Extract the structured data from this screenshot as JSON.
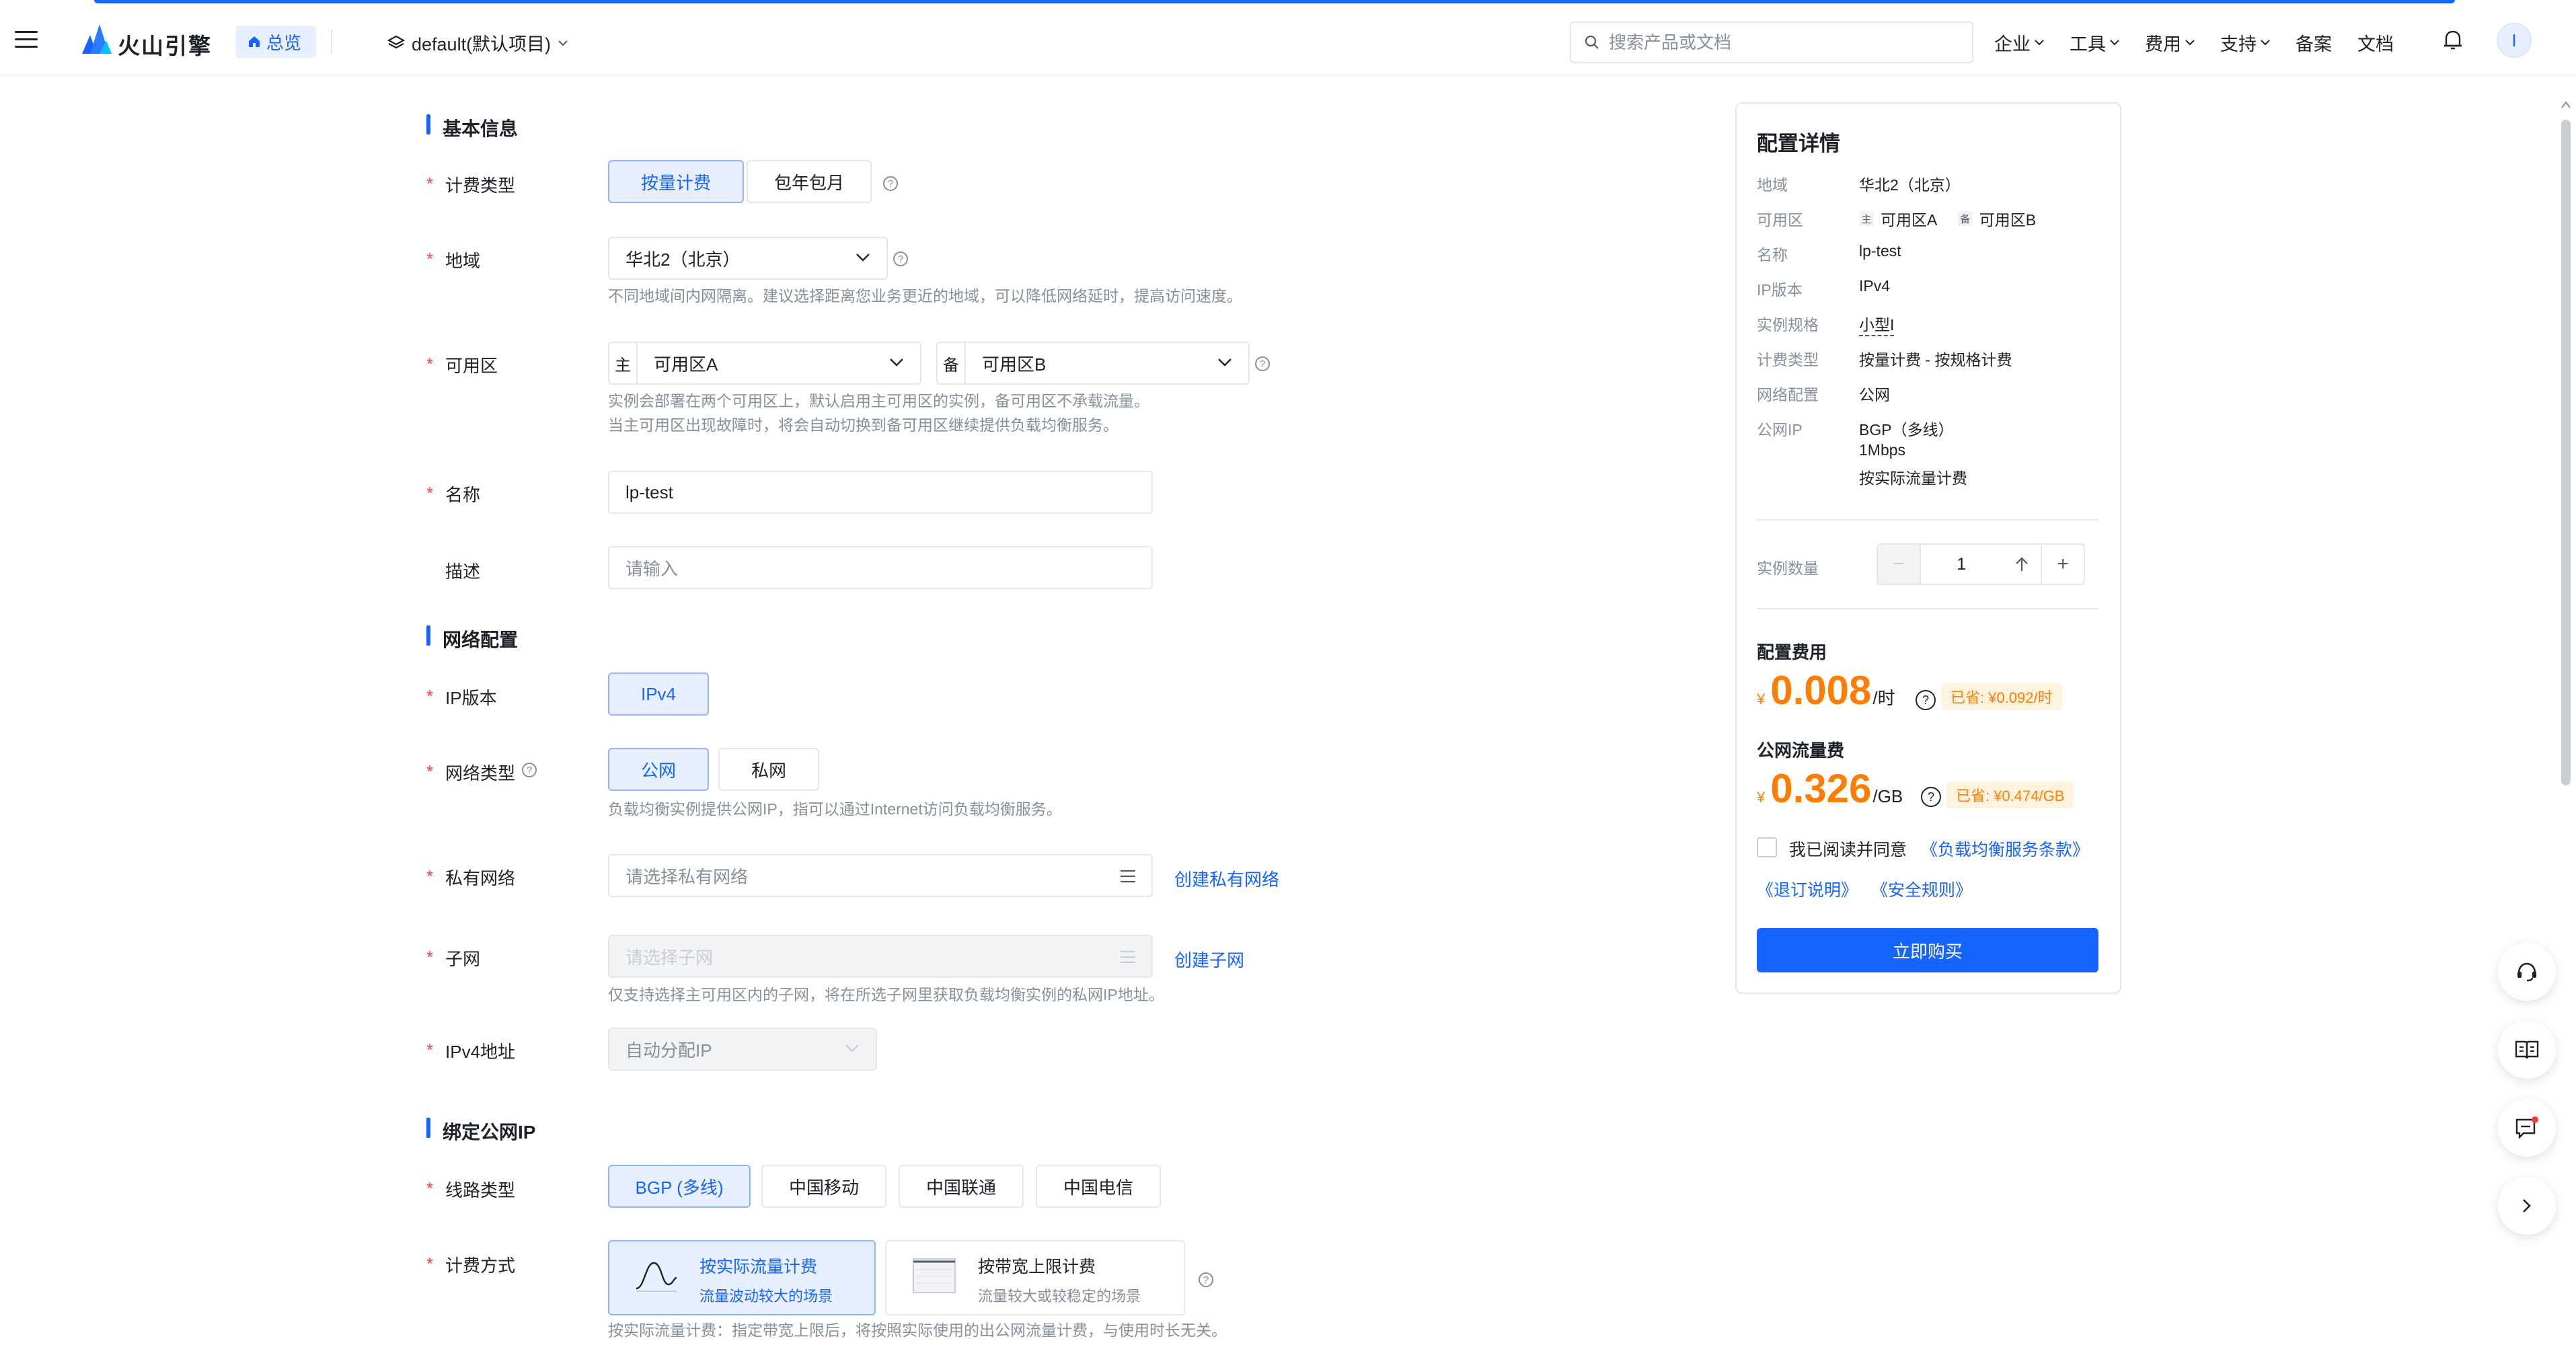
{
  "header": {
    "brand": "火山引擎",
    "home_tag": "总览",
    "project": "default(默认项目)",
    "search_placeholder": "搜索产品或文档",
    "nav": [
      "企业",
      "工具",
      "费用",
      "支持",
      "备案",
      "文档"
    ],
    "avatar_initial": "I"
  },
  "form": {
    "basic": {
      "title": "基本信息",
      "billing_label": "计费类型",
      "billing_options": [
        "按量计费",
        "包年包月"
      ],
      "region_label": "地域",
      "region_value": "华北2（北京）",
      "region_hint": "不同地域间内网隔离。建议选择距离您业务更近的地域，可以降低网络延时，提高访问速度。",
      "zone_label": "可用区",
      "zone_primary_prefix": "主",
      "zone_primary": "可用区A",
      "zone_backup_prefix": "备",
      "zone_backup": "可用区B",
      "zone_hint_1": "实例会部署在两个可用区上，默认启用主可用区的实例，备可用区不承载流量。",
      "zone_hint_2": "当主可用区出现故障时，将会自动切换到备可用区继续提供负载均衡服务。",
      "name_label": "名称",
      "name_value": "lp-test",
      "desc_label": "描述",
      "desc_placeholder": "请输入"
    },
    "network": {
      "title": "网络配置",
      "ip_label": "IP版本",
      "ip_value": "IPv4",
      "type_label": "网络类型",
      "type_options": [
        "公网",
        "私网"
      ],
      "type_hint": "负载均衡实例提供公网IP，指可以通过Internet访问负载均衡服务。",
      "vpc_label": "私有网络",
      "vpc_placeholder": "请选择私有网络",
      "vpc_link": "创建私有网络",
      "subnet_label": "子网",
      "subnet_placeholder": "请选择子网",
      "subnet_link": "创建子网",
      "subnet_hint": "仅支持选择主可用区内的子网，将在所选子网里获取负载均衡实例的私网IP地址。",
      "ipv4_label": "IPv4地址",
      "ipv4_value": "自动分配IP"
    },
    "eip": {
      "title": "绑定公网IP",
      "line_label": "线路类型",
      "line_options": [
        "BGP (多线)",
        "中国移动",
        "中国联通",
        "中国电信"
      ],
      "billing_label": "计费方式",
      "bill_opt1_title": "按实际流量计费",
      "bill_opt1_sub": "流量波动较大的场景",
      "bill_opt2_title": "按带宽上限计费",
      "bill_opt2_sub": "流量较大或较稳定的场景",
      "bill_hint": "按实际流量计费：指定带宽上限后，将按照实际使用的出公网流量计费，与使用时长无关。"
    }
  },
  "summary": {
    "title": "配置详情",
    "rows": [
      {
        "label": "地域",
        "value": "华北2（北京）"
      },
      {
        "label": "可用区",
        "value": ""
      },
      {
        "label": "名称",
        "value": "lp-test"
      },
      {
        "label": "IP版本",
        "value": "IPv4"
      },
      {
        "label": "实例规格",
        "value": "小型I"
      },
      {
        "label": "计费类型",
        "value": "按量计费 - 按规格计费"
      },
      {
        "label": "网络配置",
        "value": "公网"
      },
      {
        "label": "公网IP",
        "value": ""
      }
    ],
    "zone_a_badge": "主",
    "zone_a": "可用区A",
    "zone_b_badge": "备",
    "zone_b": "可用区B",
    "eip_lines": [
      "BGP（多线）",
      "1Mbps",
      "按实际流量计费"
    ],
    "qty_label": "实例数量",
    "qty_value": "1",
    "config_cost_label": "配置费用",
    "currency": "¥",
    "config_price": "0.008",
    "config_unit": "/时",
    "config_saved": "已省: ¥0.092/时",
    "traffic_cost_label": "公网流量费",
    "traffic_price": "0.326",
    "traffic_unit": "/GB",
    "traffic_saved": "已省: ¥0.474/GB",
    "agree_text": "我已阅读并同意",
    "agree_link1": "《负载均衡服务条款》",
    "agree_link2": "《退订说明》",
    "agree_link3": "《安全规则》",
    "buy_label": "立即购买"
  },
  "colors": {
    "accent": "#1664ff",
    "price": "#ff7d00",
    "required": "#f53f3f"
  }
}
